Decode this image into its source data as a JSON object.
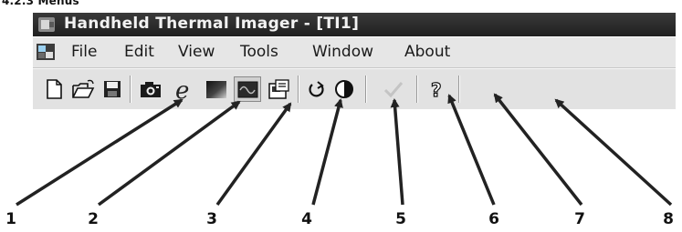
{
  "section_heading": "4.2.3  Menus",
  "window": {
    "title": "Handheld Thermal Imager - [TI1]"
  },
  "menu": {
    "items": [
      "File",
      "Edit",
      "View",
      "Tools",
      "Window",
      "About"
    ]
  },
  "toolbar": {
    "buttons": [
      {
        "icon": "new-document-icon"
      },
      {
        "icon": "open-folder-icon"
      },
      {
        "icon": "save-icon"
      },
      {
        "icon": "camera-icon"
      },
      {
        "icon": "emissivity-e-icon"
      },
      {
        "icon": "palette-gradient-icon"
      },
      {
        "icon": "waveform-icon",
        "state": "pressed"
      },
      {
        "icon": "properties-icon"
      },
      {
        "icon": "rotate-refresh-icon"
      },
      {
        "icon": "contrast-half-circle-icon"
      },
      {
        "icon": "checkmark-icon",
        "state": "disabled"
      },
      {
        "icon": "help-icon"
      }
    ]
  },
  "callouts": [
    "1",
    "2",
    "3",
    "4",
    "5",
    "6",
    "7",
    "8"
  ]
}
